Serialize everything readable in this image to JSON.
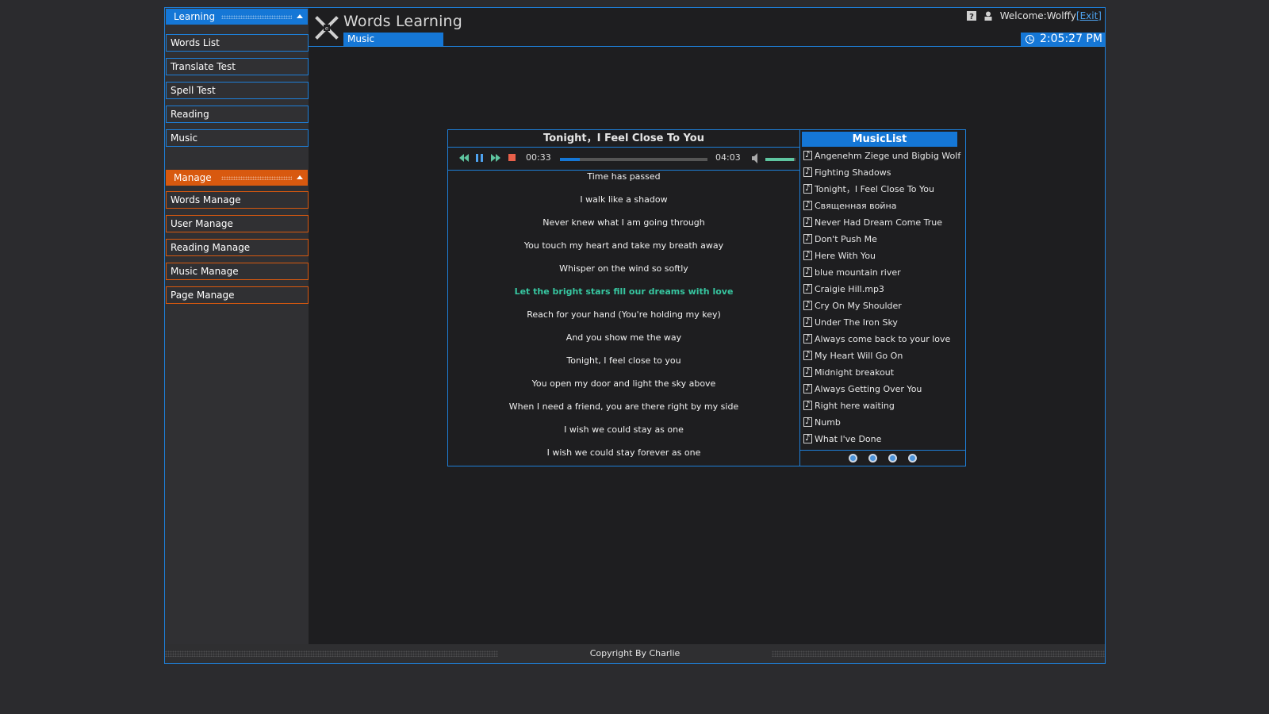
{
  "app": {
    "title": "Words Learning",
    "section": "Music"
  },
  "user": {
    "welcome": "Welcome:Wolffy",
    "exit": "[Exit]"
  },
  "clock": "2:05:27 PM",
  "sidebar": {
    "learning": {
      "header": "Learning",
      "items": [
        "Words List",
        "Translate Test",
        "Spell Test",
        "Reading",
        "Music"
      ]
    },
    "manage": {
      "header": "Manage",
      "items": [
        "Words Manage",
        "User Manage",
        "Reading Manage",
        "Music Manage",
        "Page Manage"
      ]
    }
  },
  "player": {
    "title": "Tonight，I Feel Close To You",
    "elapsed": "00:33",
    "duration": "04:03",
    "progress_fraction": 0.136,
    "volume_fraction": 0.95,
    "lyrics": [
      "Time has passed",
      "I walk like a shadow",
      "Never knew what I am going through",
      "You touch my heart and take my breath away",
      "Whisper on the wind so softly",
      "Let the bright stars fill our dreams with love",
      "Reach for your hand (You're holding my key)",
      "And you show me the way",
      "Tonight, I feel close to you",
      "You open my door and light the sky above",
      "When I need a friend, you are there right by my side",
      "I wish we could stay as one",
      "I wish we could stay forever as one"
    ],
    "active_lyric_index": 5
  },
  "music_list": {
    "header": "MusicList",
    "items": [
      "Angenehm Ziege und Bigbig Wolf",
      "Fighting Shadows",
      "Tonight，I Feel Close To You",
      "Священная война",
      "Never Had Dream Come True",
      "Don't Push Me",
      "Here With You",
      "blue mountain river",
      "Craigie Hill.mp3",
      "Cry On My Shoulder",
      "Under The Iron Sky",
      "Always come back to your love",
      "My Heart Will Go On",
      "Midnight breakout",
      "Always Getting Over You",
      "Right here waiting",
      "Numb",
      "What I've Done"
    ]
  },
  "footer": "Copyright By Charlie",
  "colors": {
    "accent_blue": "#1577d6",
    "accent_orange": "#d8590f",
    "lyric_active": "#37c6a0",
    "volume": "#5ec5a0"
  }
}
